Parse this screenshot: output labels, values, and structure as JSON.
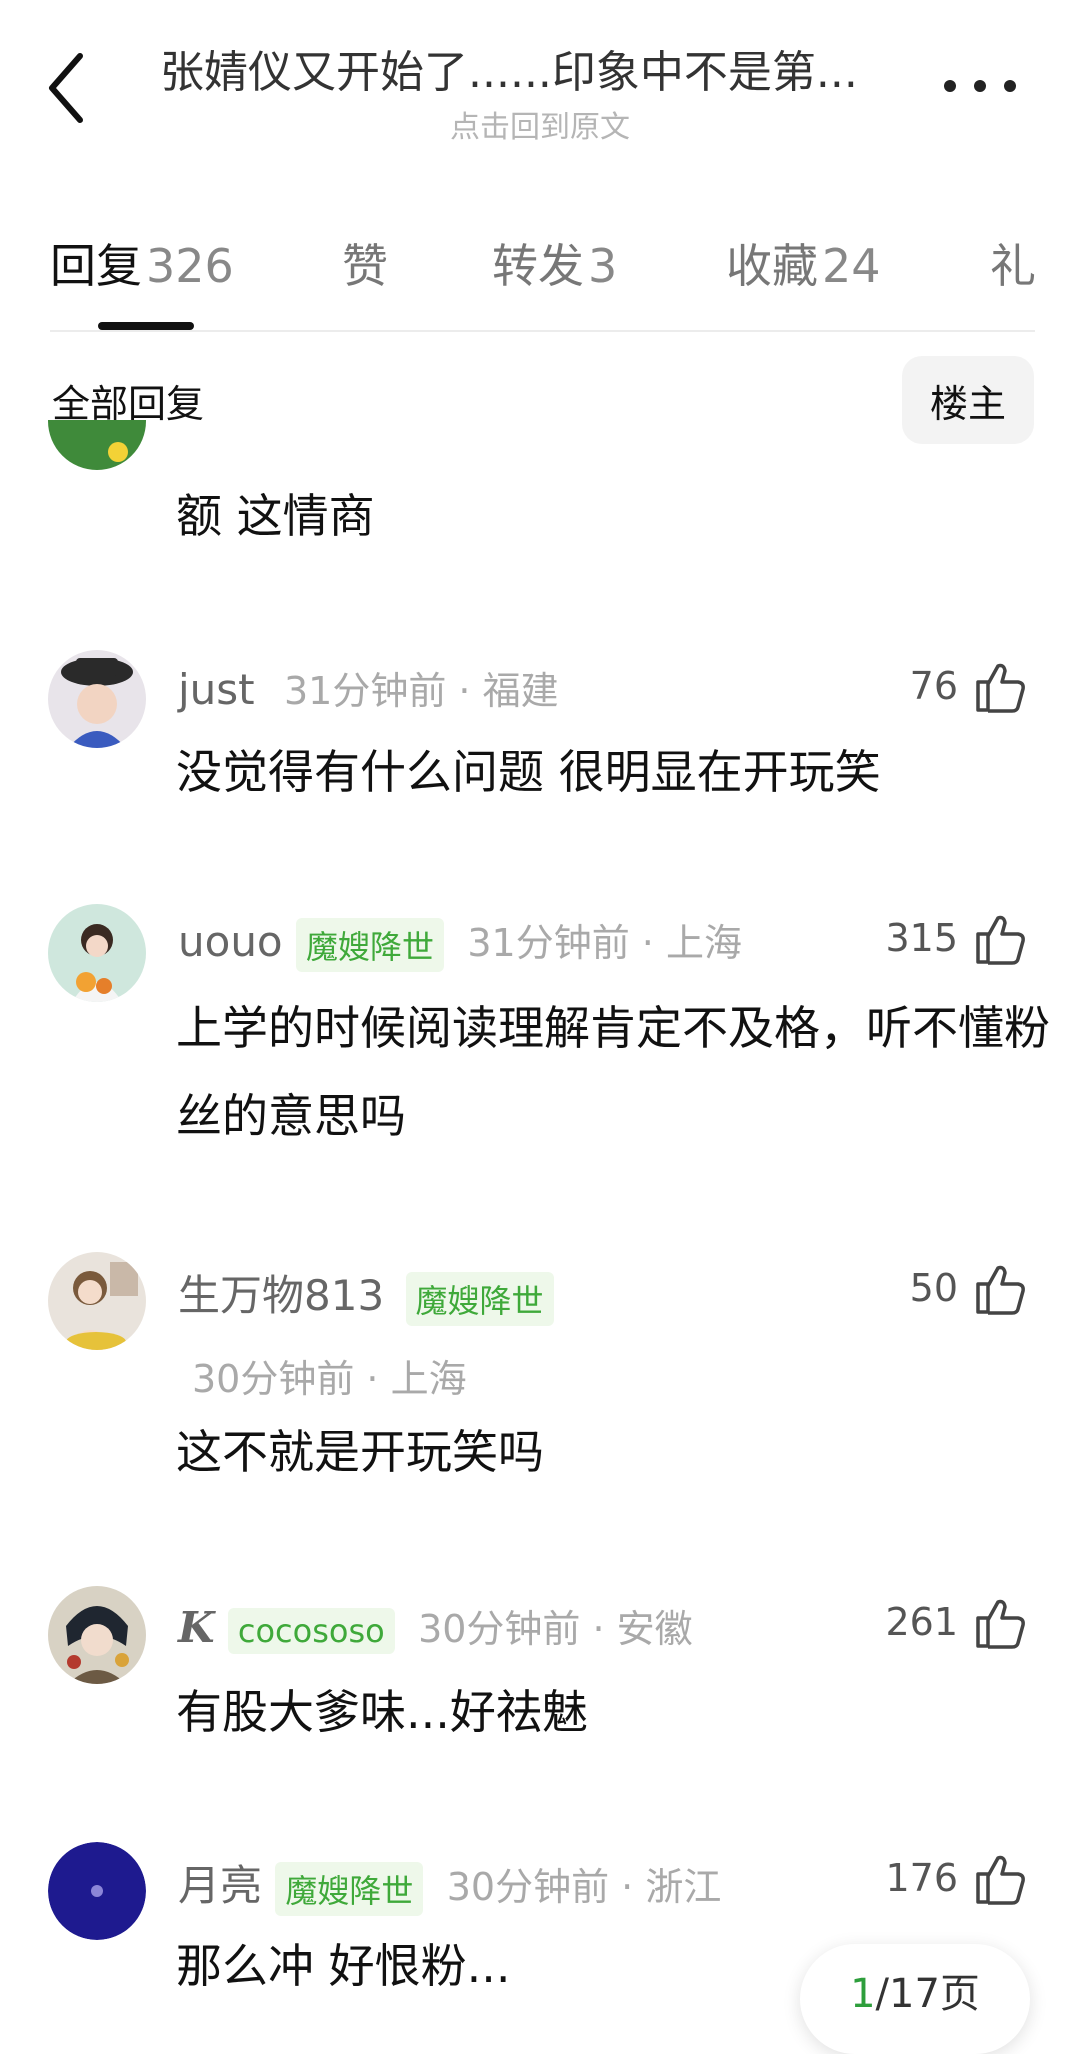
{
  "header": {
    "title": "张婧仪又开始了......印象中不是第...",
    "subtitle": "点击回到原文"
  },
  "tabs": [
    {
      "label": "回复",
      "count": "326"
    },
    {
      "label": "赞",
      "count": ""
    },
    {
      "label": "转发",
      "count": "3"
    },
    {
      "label": "收藏",
      "count": "24"
    },
    {
      "label": "礼",
      "count": ""
    }
  ],
  "section": {
    "title": "全部回复",
    "owner_button": "楼主"
  },
  "comments": [
    {
      "name": "",
      "badge": "",
      "time": "",
      "text": "额 这情商",
      "likes": ""
    },
    {
      "name": "just",
      "badge": "",
      "time": "31分钟前 · 福建",
      "text": "没觉得有什么问题 很明显在开玩笑",
      "likes": "76"
    },
    {
      "name": "uouo",
      "badge": "魔嫂降世",
      "time": "31分钟前 · 上海",
      "text": "上学的时候阅读理解肯定不及格，听不懂粉丝的意思吗",
      "likes": "315"
    },
    {
      "name": "生万物813",
      "badge": "魔嫂降世",
      "time": "30分钟前 · 上海",
      "text": "这不就是开玩笑吗",
      "likes": "50"
    },
    {
      "name": "K",
      "badge": "cocososo",
      "time": "30分钟前 · 安徽",
      "text": "有股大爹味...好祛魅",
      "likes": "261"
    },
    {
      "name": "月亮",
      "badge": "魔嫂降世",
      "time": "30分钟前 · 浙江",
      "text": "那么冲 好恨粉...",
      "likes": "176"
    }
  ],
  "pager": {
    "current": "1",
    "total": "/17页"
  },
  "icons": {
    "back": "chevron-left-icon",
    "more": "more-dots-icon",
    "like": "thumbs-up-icon"
  },
  "colors": {
    "badge_text": "#3fa93a",
    "badge_bg": "#eef8ea"
  }
}
